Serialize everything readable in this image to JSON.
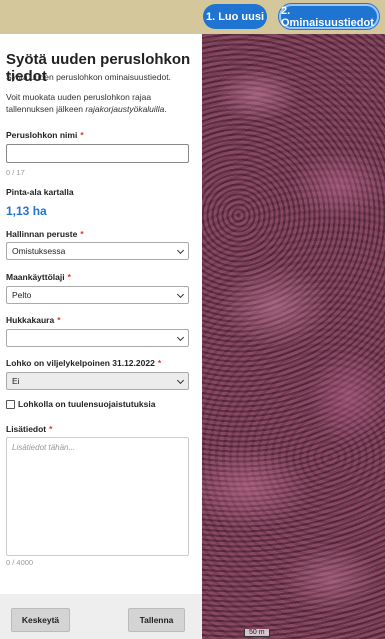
{
  "steps": [
    {
      "label": "1. Luo uusi"
    },
    {
      "label": "2. Ominaisuustiedot"
    }
  ],
  "form": {
    "title": "Syötä uuden peruslohkon tiedot",
    "subtitle": "Syötä uuden peruslohkon ominaisuustiedot.",
    "info_text": "Voit muokata uuden peruslohkon rajaa tallennuksen jälkeen",
    "info_emphasis": "rajakorjaustyökaluilla",
    "info_end": ".",
    "name": {
      "label": "Peruslohkon nimi",
      "required": "*",
      "value": "",
      "counter": "0 / 17"
    },
    "area": {
      "label": "Pinta-ala kartalla",
      "value": "1,13 ha"
    },
    "ownership": {
      "label": "Hallinnan peruste",
      "required": "*",
      "value": "Omistuksessa"
    },
    "land_use": {
      "label": "Maankäyttölaji",
      "required": "*",
      "value": "Pelto"
    },
    "wild_oat": {
      "label": "Hukkakaura",
      "required": "*",
      "value": ""
    },
    "cultivable": {
      "label": "Lohko on viljelykelpoinen 31.12.2022",
      "required": "*",
      "value": "Ei"
    },
    "windbreak": {
      "label": "Lohkolla on tuulensuojaistutuksia",
      "checked": false
    },
    "extra": {
      "label": "Lisätiedot",
      "required": "*",
      "placeholder": "Lisätiedot tähän...",
      "counter": "0 / 4000"
    }
  },
  "buttons": {
    "cancel": "Keskeytä",
    "save": "Tallenna"
  },
  "map": {
    "scale_label": "50 m"
  }
}
